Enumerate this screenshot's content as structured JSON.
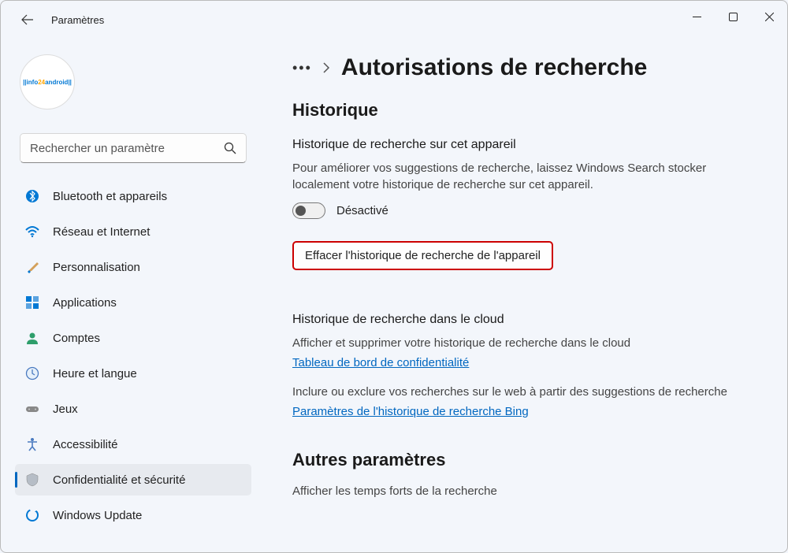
{
  "titlebar": {
    "app_title": "Paramètres"
  },
  "search": {
    "placeholder": "Rechercher un paramètre"
  },
  "sidebar": {
    "items": [
      {
        "label": "Bluetooth et appareils"
      },
      {
        "label": "Réseau et Internet"
      },
      {
        "label": "Personnalisation"
      },
      {
        "label": "Applications"
      },
      {
        "label": "Comptes"
      },
      {
        "label": "Heure et langue"
      },
      {
        "label": "Jeux"
      },
      {
        "label": "Accessibilité"
      },
      {
        "label": "Confidentialité et sécurité"
      },
      {
        "label": "Windows Update"
      }
    ]
  },
  "main": {
    "page_title": "Autorisations de recherche",
    "history_heading": "Historique",
    "device_history": {
      "title": "Historique de recherche sur cet appareil",
      "desc": "Pour améliorer vos suggestions de recherche, laissez Windows Search stocker localement votre historique de recherche sur cet appareil.",
      "toggle_label": "Désactivé",
      "clear_button": "Effacer l'historique de recherche de l'appareil"
    },
    "cloud_history": {
      "title": "Historique de recherche dans le cloud",
      "desc1": "Afficher et supprimer votre historique de recherche dans le cloud",
      "link1": "Tableau de bord de confidentialité",
      "desc2": "Inclure ou exclure vos recherches sur le web à partir des suggestions de recherche",
      "link2": "Paramètres de l'historique de recherche Bing"
    },
    "other": {
      "title": "Autres paramètres",
      "desc": "Afficher les temps forts de la recherche"
    }
  }
}
